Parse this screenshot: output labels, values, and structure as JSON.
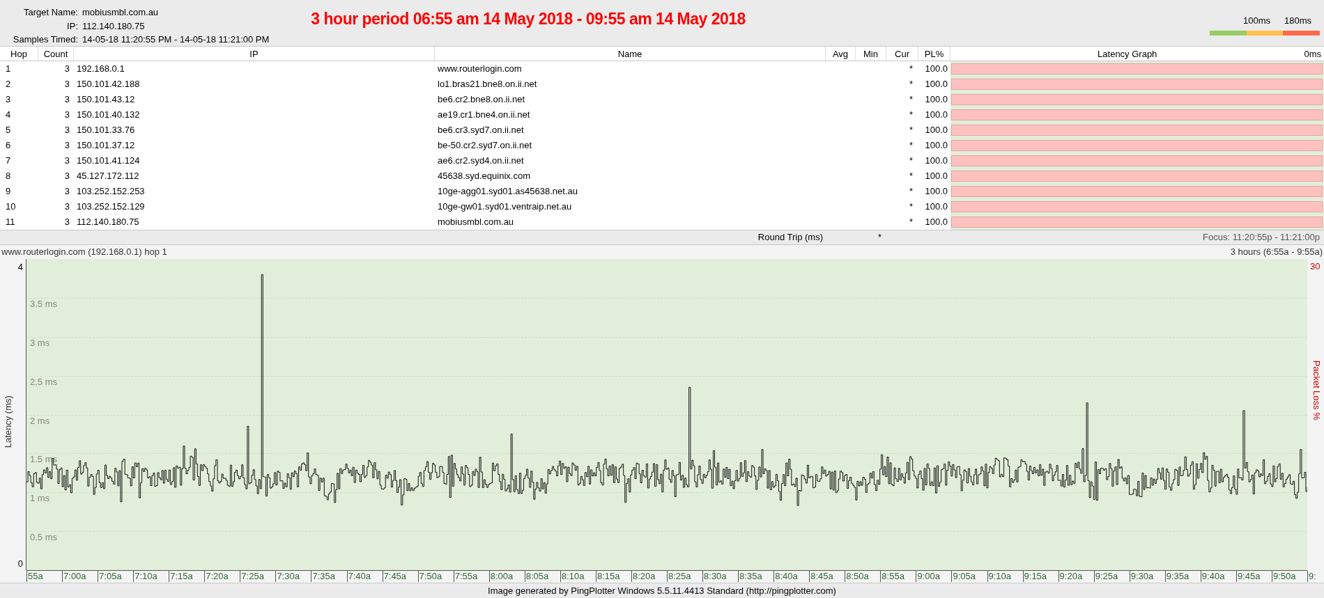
{
  "header": {
    "target_label": "Target Name:",
    "target": "mobiusmbl.com.au",
    "ip_label": "IP:",
    "ip": "112.140.180.75",
    "samples_label": "Samples Timed:",
    "samples": "14-05-18 11:20:55 PM - 14-05-18 11:21:00 PM",
    "banner": "3 hour period 06:55 am 14 May 2018 - 09:55 am 14 May 2018"
  },
  "legend": {
    "labels": [
      "100ms",
      "180ms"
    ],
    "segments": [
      {
        "color": "#99cc66"
      },
      {
        "color": "#ffc04c"
      },
      {
        "color": "#ff6a4c"
      }
    ]
  },
  "table": {
    "columns": [
      "Hop",
      "Count",
      "IP",
      "Name",
      "Avg",
      "Min",
      "Cur",
      "PL%",
      "Latency Graph"
    ],
    "scale_label": "0ms",
    "rows": [
      {
        "hop": "1",
        "count": "3",
        "ip": "192.168.0.1",
        "name": "www.routerlogin.com",
        "cur": "*",
        "pl": "100.0"
      },
      {
        "hop": "2",
        "count": "3",
        "ip": "150.101.42.188",
        "name": "lo1.bras21.bne8.on.ii.net",
        "cur": "*",
        "pl": "100.0"
      },
      {
        "hop": "3",
        "count": "3",
        "ip": "150.101.43.12",
        "name": "be6.cr2.bne8.on.ii.net",
        "cur": "*",
        "pl": "100.0"
      },
      {
        "hop": "4",
        "count": "3",
        "ip": "150.101.40.132",
        "name": "ae19.cr1.bne4.on.ii.net",
        "cur": "*",
        "pl": "100.0"
      },
      {
        "hop": "5",
        "count": "3",
        "ip": "150.101.33.76",
        "name": "be6.cr3.syd7.on.ii.net",
        "cur": "*",
        "pl": "100.0"
      },
      {
        "hop": "6",
        "count": "3",
        "ip": "150.101.37.12",
        "name": "be-50.cr2.syd7.on.ii.net",
        "cur": "*",
        "pl": "100.0"
      },
      {
        "hop": "7",
        "count": "3",
        "ip": "150.101.41.124",
        "name": "ae6.cr2.syd4.on.ii.net",
        "cur": "*",
        "pl": "100.0"
      },
      {
        "hop": "8",
        "count": "3",
        "ip": "45.127.172.112",
        "name": "45638.syd.equinix.com",
        "cur": "*",
        "pl": "100.0"
      },
      {
        "hop": "9",
        "count": "3",
        "ip": "103.252.152.253",
        "name": "10ge-agg01.syd01.as45638.net.au",
        "cur": "*",
        "pl": "100.0"
      },
      {
        "hop": "10",
        "count": "3",
        "ip": "103.252.152.129",
        "name": "10ge-gw01.syd01.ventraip.net.au",
        "cur": "*",
        "pl": "100.0"
      },
      {
        "hop": "11",
        "count": "3",
        "ip": "112.140.180.75",
        "name": "mobiusmbl.com.au",
        "cur": "*",
        "pl": "100.0"
      }
    ],
    "summary": {
      "label": "Round Trip (ms)",
      "cur": "*",
      "focus": "Focus: 11:20:55p - 11:21:00p"
    }
  },
  "graph": {
    "title": "www.routerlogin.com (192.168.0.1) hop 1",
    "range": "3 hours (6:55a - 9:55a)",
    "y_max": "4",
    "y_min": "0",
    "ylabel": "Latency (ms)",
    "gridlines": [
      "3.5 ms",
      "3 ms",
      "2.5 ms",
      "2 ms",
      "1.5 ms",
      "1 ms",
      "0.5 ms"
    ],
    "pl_max": "30",
    "pl_label": "Packet Loss %",
    "xticks": [
      "55a",
      "7:00a",
      "7:05a",
      "7:10a",
      "7:15a",
      "7:20a",
      "7:25a",
      "7:30a",
      "7:35a",
      "7:40a",
      "7:45a",
      "7:50a",
      "7:55a",
      "8:00a",
      "8:05a",
      "8:10a",
      "8:15a",
      "8:20a",
      "8:25a",
      "8:30a",
      "8:35a",
      "8:40a",
      "8:45a",
      "8:50a",
      "8:55a",
      "9:00a",
      "9:05a",
      "9:10a",
      "9:15a",
      "9:20a",
      "9:25a",
      "9:30a",
      "9:35a",
      "9:40a",
      "9:45a",
      "9:50a",
      "9:"
    ]
  },
  "footer": "Image generated by PingPlotter Windows 5.5.11.4413 Standard (http://pingplotter.com)"
}
